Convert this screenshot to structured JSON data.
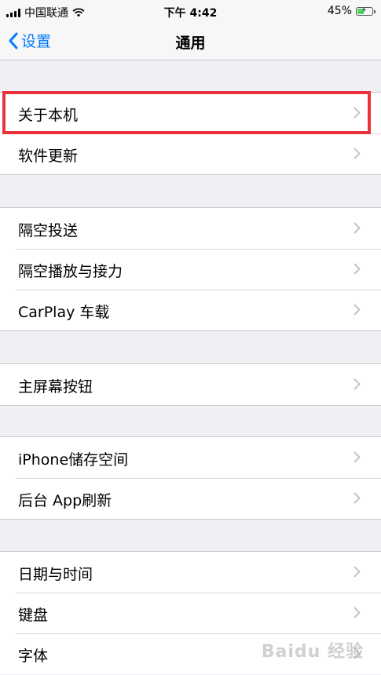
{
  "status_bar": {
    "carrier": "中国联通",
    "time": "下午 4:42",
    "battery_percent": "45%",
    "battery_level": 0.45
  },
  "nav": {
    "back_label": "设置",
    "title": "通用"
  },
  "groups": [
    {
      "items": [
        "关于本机",
        "软件更新"
      ]
    },
    {
      "items": [
        "隔空投送",
        "隔空播放与接力",
        "CarPlay 车载"
      ]
    },
    {
      "items": [
        "主屏幕按钮"
      ]
    },
    {
      "items": [
        "iPhone储存空间",
        "后台 App刷新"
      ]
    },
    {
      "items": [
        "日期与时间",
        "键盘",
        "字体"
      ]
    }
  ],
  "highlight_color": "#e8323c",
  "accent_color": "#007aff",
  "watermark": "Baidu 经验"
}
